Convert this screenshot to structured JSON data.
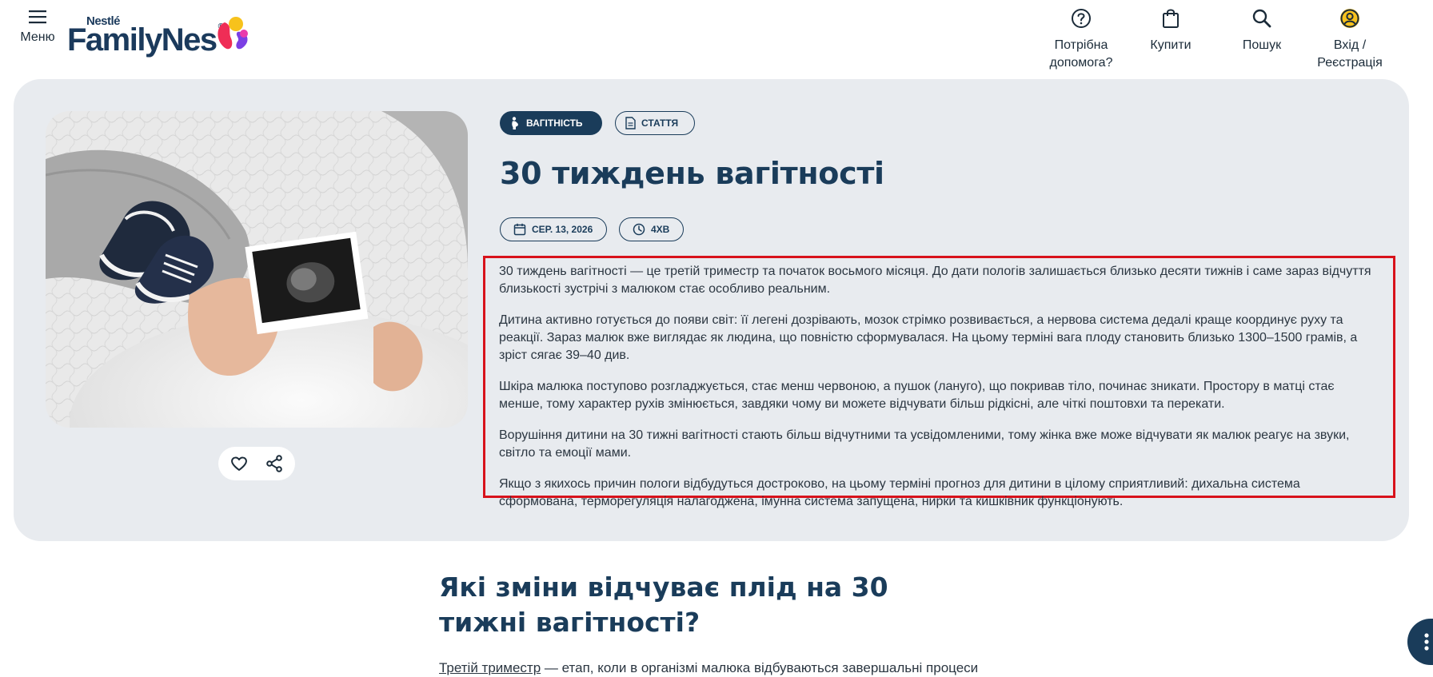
{
  "header": {
    "menu_label": "Меню",
    "logo": {
      "top": "Nestlé",
      "main": "FamilyNes",
      "reg": "®"
    },
    "nav": {
      "help_label": [
        "Потрібна",
        "допомога?"
      ],
      "buy_label": "Купити",
      "search_label": "Пошук",
      "login_label": [
        "Вхід /",
        "Реєстрація"
      ]
    }
  },
  "hero": {
    "tags": {
      "pregnancy": "Вагітність",
      "article": "Стаття"
    },
    "title": "30 тиждень вагітності",
    "meta": {
      "date": "СЕР. 13, 2026",
      "read_time": "4ХВ"
    },
    "intro_paragraphs": [
      "30 тиждень вагітності — це третій триместр та початок восьмого місяця. До дати пологів залишається близько десяти тижнів і саме зараз відчуття близькості зустрічі з малюком стає особливо реальним.",
      "Дитина активно готується до появи світ: її легені дозрівають, мозок стрімко розвивається, а нервова система дедалі краще координує руху та реакції. Зараз малюк вже виглядає як людина, що повністю сформувалася. На цьому терміні вага плоду становить близько 1300–1500 грамів, а зріст сягає 39–40 див.",
      "Шкіра малюка поступово розгладжується, стає менш червоною, а пушок (лануго), що покривав тіло, починає зникати. Простору в матці стає менше, тому характер рухів змінюється, завдяки чому ви можете відчувати більш рідкісні, але чіткі поштовхи та перекати.",
      "Ворушіння дитини на 30 тижні вагітності стають більш відчутними та усвідомленими, тому жінка вже може відчувати як малюк реагує на звуки, світло та емоції мами.",
      "Якщо з якихось причин пологи відбудуться достроково, на цьому терміні прогноз для дитини в цілому сприятливий: дихальна система сформована, терморегуляція налагоджена, імунна система запущена, нирки та кишківник функціонують."
    ]
  },
  "section": {
    "title": "Які зміни відчуває плід на 30 тижні вагітності?",
    "text_link": "Третій триместр",
    "text_rest": " — етап, коли в організмі малюка відбуваються завершальні процеси"
  },
  "colors": {
    "brand_navy": "#1a3c5a",
    "hero_bg": "#e8ebef",
    "highlight_border": "#d8121b"
  },
  "icons": {
    "menu": "hamburger-icon",
    "help": "question-circle-icon",
    "buy": "shopping-bag-icon",
    "search": "search-icon",
    "login": "user-circle-icon",
    "favorite": "heart-icon",
    "share": "share-icon",
    "date": "calendar-icon",
    "time": "clock-icon"
  }
}
